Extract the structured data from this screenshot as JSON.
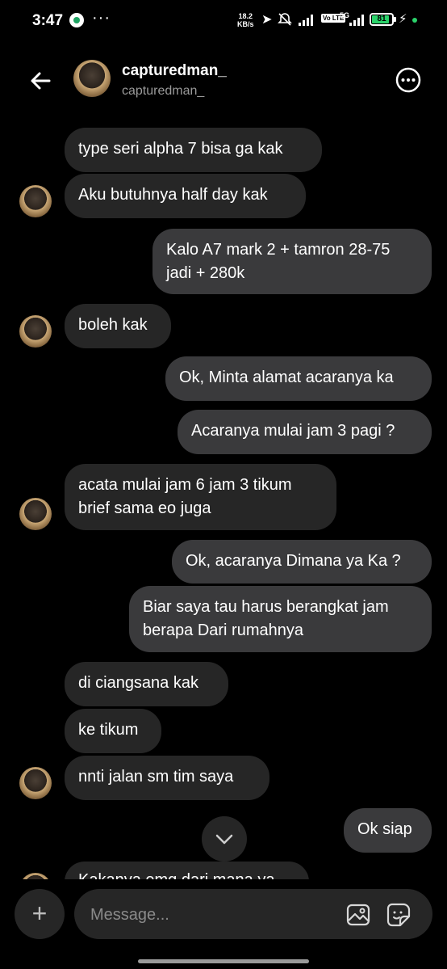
{
  "status_bar": {
    "time": "3:47",
    "more_indicator": "···",
    "net_speed_value": "18.2",
    "net_speed_unit": "KB/s",
    "volte_label": "Vo LTE",
    "network_type": "5G",
    "battery_level": "81"
  },
  "header": {
    "username": "capturedman_",
    "handle": "capturedman_"
  },
  "messages": [
    {
      "id": "m1",
      "direction": "incoming",
      "text": "type seri alpha 7 bisa ga kak"
    },
    {
      "id": "m2",
      "direction": "incoming",
      "text": "Aku butuhnya half day kak"
    },
    {
      "id": "m3",
      "direction": "outgoing",
      "line1": "Kalo A7 mark 2 + tamron 28-75",
      "line2": "jadi  + 280k"
    },
    {
      "id": "m4",
      "direction": "incoming",
      "text": "boleh kak"
    },
    {
      "id": "m5",
      "direction": "outgoing",
      "text": "Ok, Minta alamat acaranya ka"
    },
    {
      "id": "m6",
      "direction": "outgoing",
      "text": "Acaranya mulai jam 3 pagi ?"
    },
    {
      "id": "m7",
      "direction": "incoming",
      "line1": "acata mulai jam 6 jam 3 tikum",
      "line2": "brief sama eo juga"
    },
    {
      "id": "m8",
      "direction": "outgoing",
      "text": "Ok, acaranya Dimana ya Ka ?"
    },
    {
      "id": "m9",
      "direction": "outgoing",
      "line1": "Biar saya tau harus berangkat jam",
      "line2": "berapa Dari rumahnya"
    },
    {
      "id": "m10",
      "direction": "incoming",
      "text": "di ciangsana kak"
    },
    {
      "id": "m11",
      "direction": "incoming",
      "text": "ke tikum"
    },
    {
      "id": "m12",
      "direction": "incoming",
      "text": "nnti jalan sm tim saya"
    },
    {
      "id": "m13",
      "direction": "outgoing",
      "text": "Ok siap"
    },
    {
      "id": "m14",
      "direction": "incoming",
      "text": "Kakanya emg dari mana ya"
    }
  ],
  "composer": {
    "placeholder": "Message..."
  },
  "icons": {
    "back": "arrow-left-icon",
    "more": "more-options-icon",
    "scroll": "chevron-down-icon",
    "plus": "plus-icon",
    "gallery": "gallery-icon",
    "sticker": "sticker-icon"
  },
  "colors": {
    "background": "#000000",
    "incoming_bubble": "#262626",
    "outgoing_bubble": "#3a3a3c",
    "battery_fill": "#2bd36b"
  }
}
